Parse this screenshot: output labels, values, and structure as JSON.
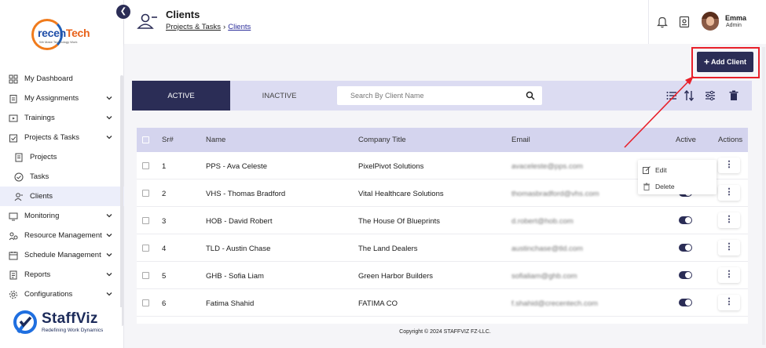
{
  "logo": {
    "text_main": "recen",
    "text_accent": "Tech",
    "tagline": "We Make Technology Work"
  },
  "sidebar": {
    "items": [
      {
        "label": "My Dashboard",
        "icon": "dashboard-icon",
        "expandable": false
      },
      {
        "label": "My Assignments",
        "icon": "clipboard-icon",
        "expandable": true
      },
      {
        "label": "Trainings",
        "icon": "video-icon",
        "expandable": true
      },
      {
        "label": "Projects & Tasks",
        "icon": "projects-icon",
        "expandable": true
      },
      {
        "label": "Projects",
        "icon": "project-doc-icon",
        "expandable": false
      },
      {
        "label": "Tasks",
        "icon": "task-check-icon",
        "expandable": false
      },
      {
        "label": "Clients",
        "icon": "clients-icon",
        "expandable": false,
        "active": true
      },
      {
        "label": "Monitoring",
        "icon": "monitor-icon",
        "expandable": true
      },
      {
        "label": "Resource Management",
        "icon": "resource-icon",
        "expandable": true
      },
      {
        "label": "Schedule Management",
        "icon": "schedule-icon",
        "expandable": true
      },
      {
        "label": "Reports",
        "icon": "reports-icon",
        "expandable": true
      },
      {
        "label": "Configurations",
        "icon": "config-icon",
        "expandable": true
      }
    ]
  },
  "brand": {
    "name": "StaffViz",
    "tagline": "Redefining Work Dynamics"
  },
  "header": {
    "title": "Clients",
    "breadcrumb": [
      "Projects & Tasks",
      "Clients"
    ],
    "breadcrumb_sep": "›",
    "user_name": "Emma",
    "user_role": "Admin"
  },
  "toolbar": {
    "add_label": "Add Client",
    "tabs": [
      "ACTIVE",
      "INACTIVE"
    ],
    "search_placeholder": "Search By Client Name"
  },
  "table": {
    "columns": [
      "Sr#",
      "Name",
      "Company Title",
      "Email",
      "Active",
      "Actions"
    ],
    "rows": [
      {
        "sr": "1",
        "name": "PPS - Ava Celeste",
        "company": "PixelPivot Solutions",
        "email": "avaceleste@pps.com",
        "active": true
      },
      {
        "sr": "2",
        "name": "VHS - Thomas Bradford",
        "company": "Vital Healthcare Solutions",
        "email": "thomasbradford@vhs.com",
        "active": true
      },
      {
        "sr": "3",
        "name": "HOB - David Robert",
        "company": "The House Of Blueprints",
        "email": "d.robert@hob.com",
        "active": true
      },
      {
        "sr": "4",
        "name": "TLD - Austin Chase",
        "company": "The Land Dealers",
        "email": "austinchase@tld.com",
        "active": true
      },
      {
        "sr": "5",
        "name": "GHB - Sofia Liam",
        "company": "Green Harbor Builders",
        "email": "sofialiam@ghb.com",
        "active": true
      },
      {
        "sr": "6",
        "name": "Fatima Shahid",
        "company": "FATIMA CO",
        "email": "f.shahid@crecentech.com",
        "active": true
      }
    ]
  },
  "context_menu": {
    "edit": "Edit",
    "delete": "Delete"
  },
  "footer": {
    "copyright": "Copyright © 2024 STAFFVIZ FZ-LLC."
  },
  "colors": {
    "primary": "#2b2d56",
    "tab_bar": "#dcdcf2",
    "highlight": "#e8202a"
  }
}
